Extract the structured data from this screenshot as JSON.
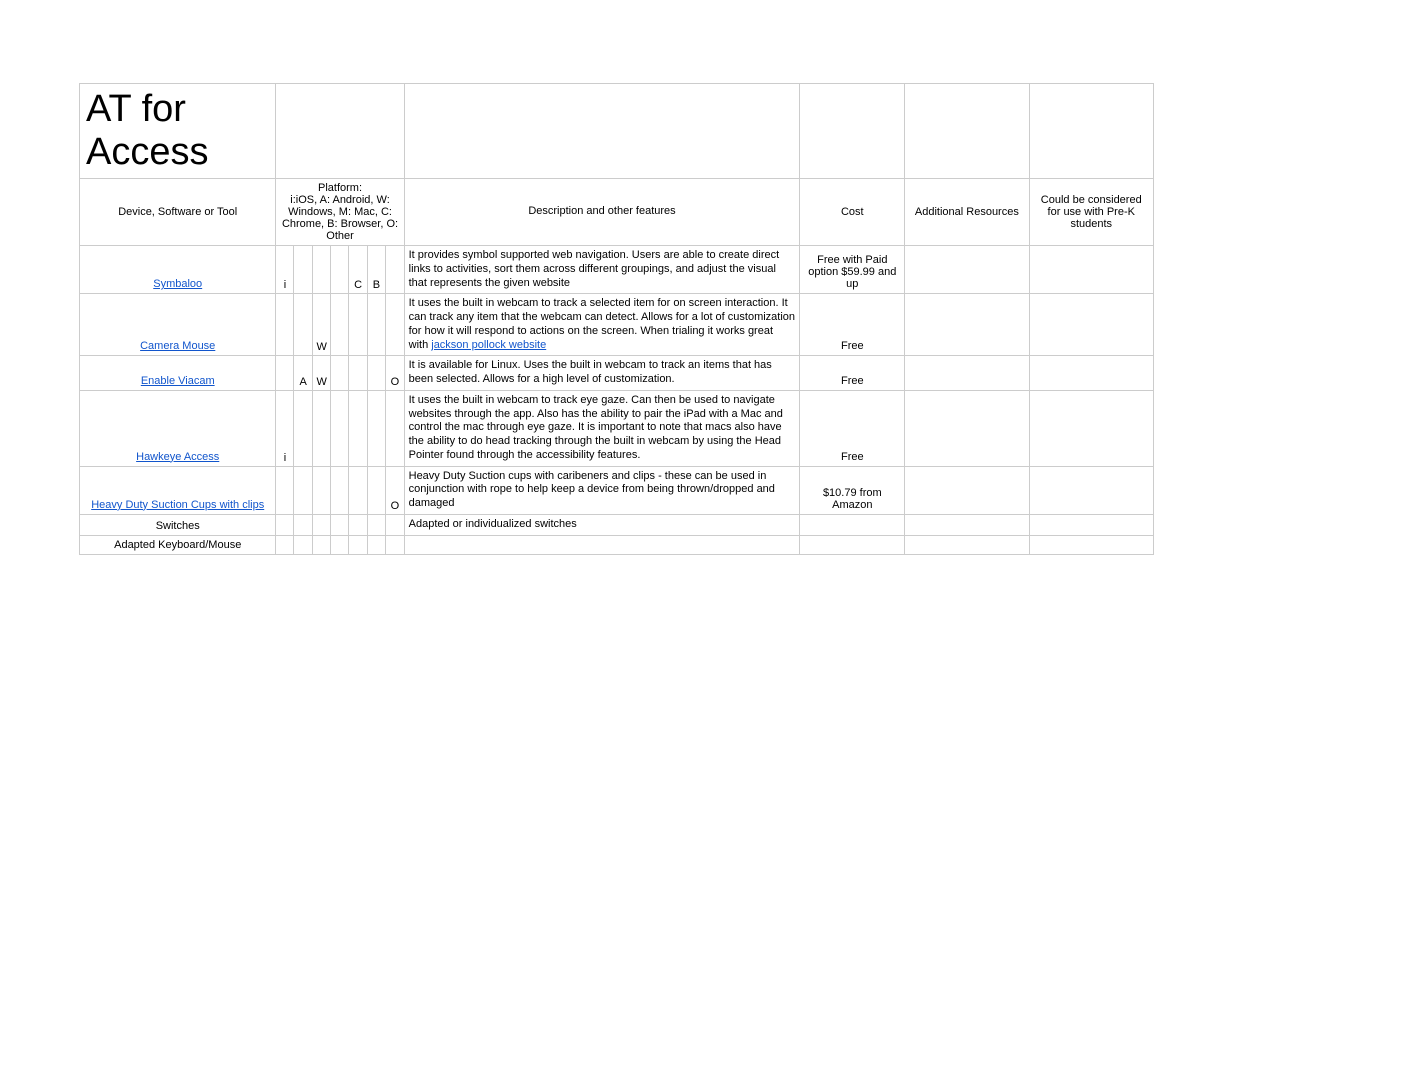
{
  "title": "AT for Access",
  "headers": {
    "device": "Device, Software or Tool",
    "platform": "Platform:\ni:iOS, A: Android, W: Windows, M: Mac, C: Chrome, B: Browser, O: Other",
    "description": "Description and other features",
    "cost": "Cost",
    "resources": "Additional Resources",
    "prek": "Could be considered for use with Pre-K students"
  },
  "platform_keys": [
    "i",
    "A",
    "W",
    "M",
    "C",
    "B",
    "O"
  ],
  "rows": [
    {
      "name": "Symbaloo",
      "name_is_link": true,
      "platforms": {
        "i": "i",
        "A": "",
        "W": "",
        "M": "",
        "C": "C",
        "B": "B",
        "O": ""
      },
      "description": "It provides symbol supported web navigation. Users are able to create direct links to activities, sort them across different groupings, and adjust the visual that represents the given website",
      "desc_link_text": "",
      "cost": "Free with Paid option $59.99 and up",
      "resources": "",
      "prek": ""
    },
    {
      "name": "Camera Mouse",
      "name_is_link": true,
      "platforms": {
        "i": "",
        "A": "",
        "W": "W",
        "M": "",
        "C": "",
        "B": "",
        "O": ""
      },
      "description": "It uses the built in webcam to track a selected item for on screen interaction. It can track any item that the webcam can detect. Allows for a lot of customization for how it will respond to actions on the screen. When trialing it works great with ",
      "desc_link_text": "jackson pollock website",
      "cost": "Free",
      "resources": "",
      "prek": ""
    },
    {
      "name": "Enable Viacam",
      "name_is_link": true,
      "platforms": {
        "i": "",
        "A": "A",
        "W": "W",
        "M": "",
        "C": "",
        "B": "",
        "O": "O"
      },
      "description": "It is available for Linux. Uses the built in webcam to track an items that has been selected. Allows for a high level of customization.",
      "desc_link_text": "",
      "cost": "Free",
      "resources": "",
      "prek": ""
    },
    {
      "name": "Hawkeye Access",
      "name_is_link": true,
      "platforms": {
        "i": "i",
        "A": "",
        "W": "",
        "M": "",
        "C": "",
        "B": "",
        "O": ""
      },
      "description": "It uses the built in webcam to track eye gaze. Can then be used to navigate websites through the app. Also has the ability to pair the iPad with a Mac and control the mac through eye gaze. It is important to note that macs also have the ability to do head tracking through the built in webcam by using the Head Pointer found through the accessibility features.",
      "desc_link_text": "",
      "cost": "Free",
      "resources": "",
      "prek": ""
    },
    {
      "name": "Heavy Duty Suction Cups with clips",
      "name_is_link": true,
      "platforms": {
        "i": "",
        "A": "",
        "W": "",
        "M": "",
        "C": "",
        "B": "",
        "O": "O"
      },
      "description": "Heavy Duty Suction cups with caribeners and clips - these can be used in conjunction with rope to help keep a device from being thrown/dropped and damaged",
      "desc_link_text": "",
      "cost": "$10.79 from Amazon",
      "resources": "",
      "prek": ""
    },
    {
      "name": "Switches",
      "name_is_link": false,
      "platforms": {
        "i": "",
        "A": "",
        "W": "",
        "M": "",
        "C": "",
        "B": "",
        "O": ""
      },
      "description": "Adapted or individualized switches",
      "desc_link_text": "",
      "cost": "",
      "resources": "",
      "prek": ""
    },
    {
      "name": "Adapted Keyboard/Mouse",
      "name_is_link": false,
      "platforms": {
        "i": "",
        "A": "",
        "W": "",
        "M": "",
        "C": "",
        "B": "",
        "O": ""
      },
      "description": "",
      "desc_link_text": "",
      "cost": "",
      "resources": "",
      "prek": ""
    }
  ]
}
